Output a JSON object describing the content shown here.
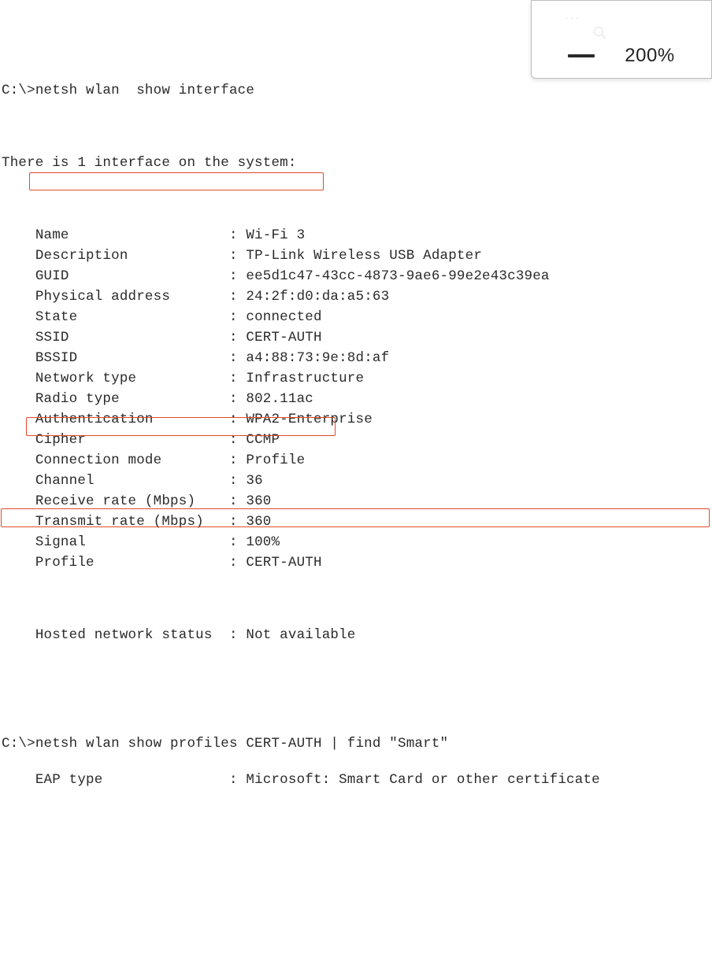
{
  "magnifier": {
    "faded_text": "···",
    "zoom": "200%"
  },
  "cmd1": {
    "prompt": "C:\\>",
    "command": "netsh wlan  show interface"
  },
  "summary": "There is 1 interface on the system:",
  "fields": [
    {
      "label": "Name",
      "value": "Wi-Fi 3"
    },
    {
      "label": "Description",
      "value": "TP-Link Wireless USB Adapter"
    },
    {
      "label": "GUID",
      "value": "ee5d1c47-43cc-4873-9ae6-99e2e43c39ea"
    },
    {
      "label": "Physical address",
      "value": "24:2f:d0:da:a5:63"
    },
    {
      "label": "State",
      "value": "connected"
    },
    {
      "label": "SSID",
      "value": "CERT-AUTH"
    },
    {
      "label": "BSSID",
      "value": "a4:88:73:9e:8d:af"
    },
    {
      "label": "Network type",
      "value": "Infrastructure"
    },
    {
      "label": "Radio type",
      "value": "802.11ac"
    },
    {
      "label": "Authentication",
      "value": "WPA2-Enterprise"
    },
    {
      "label": "Cipher",
      "value": "CCMP"
    },
    {
      "label": "Connection mode",
      "value": "Profile"
    },
    {
      "label": "Channel",
      "value": "36"
    },
    {
      "label": "Receive rate (Mbps)",
      "value": "360"
    },
    {
      "label": "Transmit rate (Mbps)",
      "value": "360"
    },
    {
      "label": "Signal",
      "value": "100%"
    },
    {
      "label": "Profile",
      "value": "CERT-AUTH"
    }
  ],
  "hosted": {
    "label": "Hosted network status",
    "value": "Not available"
  },
  "cmd2": {
    "prompt": "C:\\>",
    "command": "netsh wlan show profiles CERT-AUTH | find \"Smart\""
  },
  "eap": {
    "label": "EAP type",
    "value": "Microsoft: Smart Card or other certificate"
  }
}
